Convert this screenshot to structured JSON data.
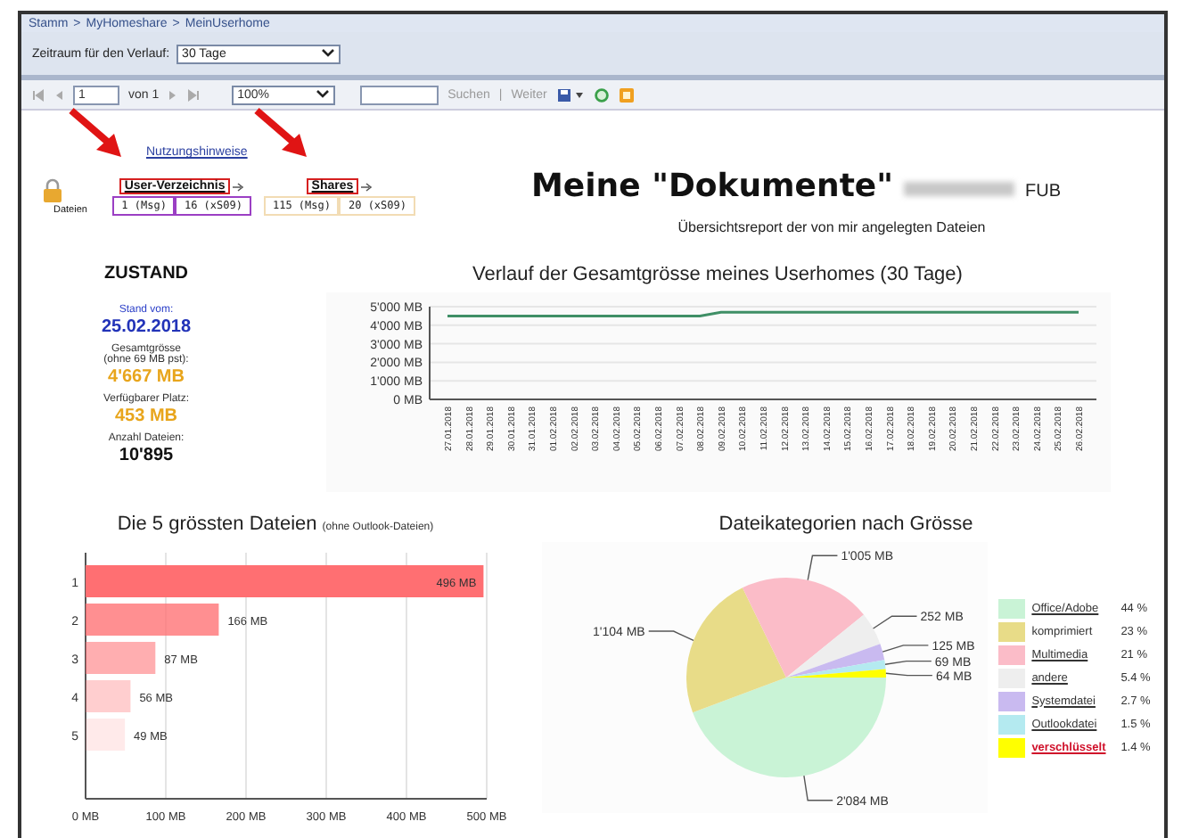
{
  "breadcrumb": {
    "separator": ">",
    "items": [
      "Stamm",
      "MyHomeshare",
      "MeinUserhome"
    ]
  },
  "parameter": {
    "label": "Zeitraum für den Verlauf:",
    "value": "30 Tage"
  },
  "toolbar": {
    "page": "1",
    "page_of": "von 1",
    "zoom": "100%",
    "find": "Suchen",
    "separator": "|",
    "next": "Weiter"
  },
  "header": {
    "help_link": "Nutzungshinweise",
    "files_label": "Dateien",
    "groups": [
      {
        "title": "User-Verzeichnis",
        "color": "#9b3fc4",
        "counts": [
          "1 (Msg)",
          "16 (xS09)"
        ]
      },
      {
        "title": "Shares",
        "color": "#f2dcb4",
        "counts": [
          "115 (Msg)",
          "20 (xS09)"
        ]
      }
    ],
    "title": "Meine \"Dokumente\"",
    "owner_suffix": "FUB",
    "subtitle": "Übersichtsreport der von mir angelegten Dateien"
  },
  "status": {
    "heading": "ZUSTAND",
    "items": [
      {
        "label": "Stand vom:",
        "value": "25.02.2018",
        "kind": "date"
      },
      {
        "label": "Gesamtgrösse\n(ohne 69 MB pst):",
        "value": "4'667 MB",
        "kind": "size"
      },
      {
        "label": "Verfügbarer Platz:",
        "value": "453 MB",
        "kind": "size"
      },
      {
        "label": "Anzahl Dateien:",
        "value": "10'895",
        "kind": "count"
      }
    ]
  },
  "history": {
    "title": "Verlauf der Gesamtgrösse meines Userhomes (30 Tage)",
    "chart_data": {
      "type": "line",
      "x": [
        "27.01.2018",
        "28.01.2018",
        "29.01.2018",
        "30.01.2018",
        "31.01.2018",
        "01.02.2018",
        "02.02.2018",
        "03.02.2018",
        "04.02.2018",
        "05.02.2018",
        "06.02.2018",
        "07.02.2018",
        "08.02.2018",
        "09.02.2018",
        "10.02.2018",
        "11.02.2018",
        "12.02.2018",
        "13.02.2018",
        "14.02.2018",
        "15.02.2018",
        "16.02.2018",
        "17.02.2018",
        "18.02.2018",
        "19.02.2018",
        "20.02.2018",
        "21.02.2018",
        "22.02.2018",
        "23.02.2018",
        "24.02.2018",
        "25.02.2018",
        "26.02.2018"
      ],
      "series": [
        {
          "color": "#3f8f66",
          "values": [
            4500,
            4500,
            4500,
            4500,
            4500,
            4500,
            4500,
            4500,
            4500,
            4500,
            4500,
            4500,
            4500,
            4700,
            4700,
            4700,
            4700,
            4700,
            4700,
            4700,
            4700,
            4700,
            4700,
            4700,
            4700,
            4700,
            4700,
            4700,
            4700,
            4700,
            4700
          ]
        }
      ],
      "ylim": [
        0,
        5000
      ],
      "grid": true,
      "yticks": [
        {
          "value": 0,
          "label": "0 MB"
        },
        {
          "value": 1000,
          "label": "1'000 MB"
        },
        {
          "value": 2000,
          "label": "2'000 MB"
        },
        {
          "value": 3000,
          "label": "3'000 MB"
        },
        {
          "value": 4000,
          "label": "4'000 MB"
        },
        {
          "value": 5000,
          "label": "5'000 MB"
        }
      ]
    }
  },
  "top_files": {
    "title": "Die 5 grössten Dateien",
    "note": "(ohne Outlook-Dateien)",
    "chart_data": {
      "type": "bar",
      "orientation": "horizontal",
      "categories": [
        "1",
        "2",
        "3",
        "4",
        "5"
      ],
      "series": [
        {
          "color": "#ff6f72",
          "values": [
            496,
            166,
            87,
            56,
            49
          ]
        }
      ],
      "xlim": [
        0,
        500
      ],
      "grid": true,
      "xticks": [
        {
          "value": 0,
          "label": "0 MB"
        },
        {
          "value": 100,
          "label": "100 MB"
        },
        {
          "value": 200,
          "label": "200 MB"
        },
        {
          "value": 300,
          "label": "300 MB"
        },
        {
          "value": 400,
          "label": "400 MB"
        },
        {
          "value": 500,
          "label": "500 MB"
        }
      ],
      "value_labels": [
        "496 MB",
        "166 MB",
        "87 MB",
        "56 MB",
        "49 MB"
      ]
    }
  },
  "categories": {
    "title": "Dateikategorien nach Grösse",
    "chart_data": {
      "type": "pie",
      "categories": [
        "Office/Adobe",
        "komprimiert",
        "Multimedia",
        "andere",
        "Systemdatei",
        "Outlookdatei",
        "verschlüsselt"
      ],
      "values": [
        2084,
        1104,
        1005,
        252,
        125,
        69,
        64
      ],
      "value_labels": [
        "2'084 MB",
        "1'104 MB",
        "1'005 MB",
        "252 MB",
        "125 MB",
        "69 MB",
        "64 MB"
      ]
    },
    "legend": [
      {
        "color": "#c9f3d6",
        "percent": "44 %",
        "link": true,
        "alert": false
      },
      {
        "color": "#e8dc88",
        "percent": "23 %",
        "link": false,
        "alert": false
      },
      {
        "color": "#fbbcc8",
        "percent": "21 %",
        "link": true,
        "alert": false
      },
      {
        "color": "#eeeeee",
        "percent": "5.4 %",
        "link": true,
        "alert": false
      },
      {
        "color": "#c9baf0",
        "percent": "2.7 %",
        "link": true,
        "alert": false
      },
      {
        "color": "#b4eaf0",
        "percent": "1.5 %",
        "link": true,
        "alert": false
      },
      {
        "color": "#ffff00",
        "percent": "1.4 %",
        "link": true,
        "alert": true
      }
    ]
  }
}
